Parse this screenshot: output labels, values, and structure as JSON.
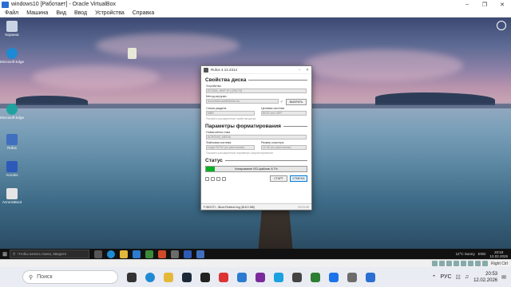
{
  "host": {
    "title": "windows10 [Работает] - Oracle VirtualBox",
    "menu": [
      "Файл",
      "Машина",
      "Вид",
      "Ввод",
      "Устройства",
      "Справка"
    ],
    "status_text": "Right Ctrl",
    "taskbar": {
      "search_placeholder": "Поиск",
      "lang": "РУС",
      "time": "20:53",
      "date": "12.02.2026"
    }
  },
  "guest": {
    "desktop_icons": [
      {
        "label": "Корзина",
        "icon": "recycle-bin-icon",
        "color": "#c8d4e4"
      },
      {
        "label": "Microsoft Edge",
        "icon": "edge-icon",
        "color": "#1f8ad4"
      },
      {
        "label": "Microsoft Edge",
        "icon": "edge-icon",
        "color": "#1fa3a0"
      },
      {
        "label": "Rufus",
        "icon": "rufus-icon",
        "color": "#3f6fbf"
      },
      {
        "label": "Acronis",
        "icon": "acronis-icon",
        "color": "#2d5ab8"
      },
      {
        "label": "AcronisBoot",
        "icon": "file-icon",
        "color": "#e5e5e5"
      }
    ],
    "center_file_label": "",
    "user_label": "",
    "taskbar": {
      "search_placeholder": "Чтобы начать поиск, введите",
      "weather": "12°C Sunny",
      "lang": "ENG",
      "time": "20:53",
      "date": "12.02.2026"
    }
  },
  "rufus": {
    "title": "Rufus 4.12.2314",
    "sections": {
      "drive_props": "Свойства диска",
      "format_opts": "Параметры форматирования",
      "status": "Статус"
    },
    "device_label": "Устройство",
    "device_value": "ЕСОМА_ЖНР (F:) [256 ГБ]",
    "boot_label": "Метод загрузки",
    "boot_value": "AcronisBootableMedia.iso",
    "select_button": "ВЫБРАТЬ",
    "partition_label": "Схема раздела",
    "partition_value": "MBR",
    "target_label": "Целевая система",
    "target_value": "BIOS или UEFI",
    "adv_drive_link": "Показать расширенные свойства диска",
    "volume_label": "Новая метка тома",
    "volume_value": "ACRONIS_MEDIA",
    "fs_label": "Файловая система",
    "fs_value": "Large FAT32 (по умолчанию)",
    "cluster_label": "Размер кластера",
    "cluster_value": "32 КБ (по умолчанию)",
    "adv_format_link": "Показать расширенные параметры форматирования",
    "progress_text": "Копирование ISO-файлов: 8.7%",
    "progress_value": 0.087,
    "start_button": "СТАРТ",
    "cancel_button": "ОТМЕНА",
    "statusbar_text": "F:\\BOOT\\...\\Boot-Rebinst.img (818.0 MB)",
    "elapsed": "00:01:05"
  }
}
